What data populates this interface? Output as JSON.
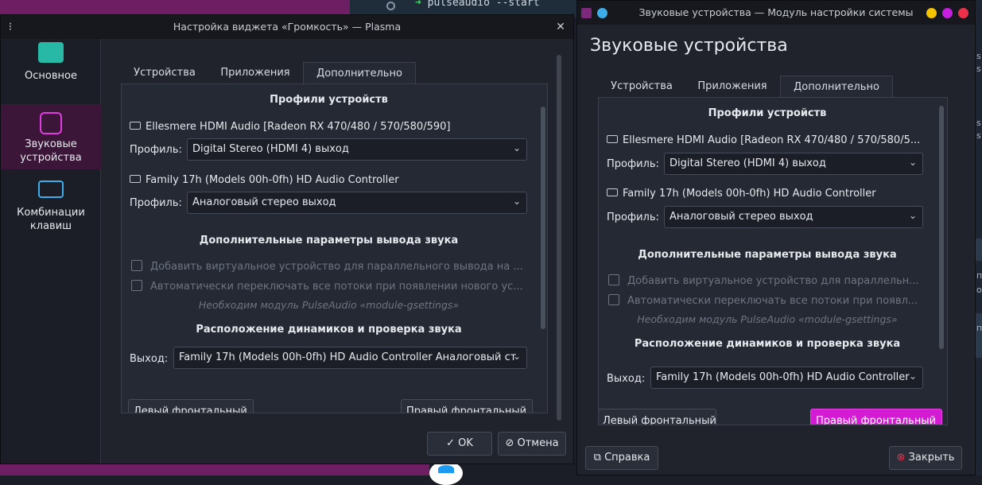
{
  "background": {
    "terminal_command": "pulseaudio --start",
    "terminal_prompt": "➜",
    "strip_texts": [
      "s",
      "s",
      "s",
      "s",
      "пр",
      "оп",
      "пр"
    ]
  },
  "left_window": {
    "title": "Настройка виджета «Громкость» — Plasma",
    "heading_partial": "Звуковые устройства",
    "sidebar": [
      {
        "label": "Основное",
        "icon": "general-settings-icon",
        "active": false
      },
      {
        "label": "Звуковые устройства",
        "icon": "audio-devices-icon",
        "active": true
      },
      {
        "label": "Комбинации клавиш",
        "icon": "keyboard-icon",
        "active": false
      }
    ],
    "tabs": [
      "Устройства",
      "Приложения",
      "Дополнительно"
    ],
    "active_tab": "Дополнительно",
    "profiles_title": "Профили устройств",
    "device1": "Ellesmere HDMI Audio [Radeon RX 470/480 / 570/580/590]",
    "profile_label": "Профиль:",
    "device1_profile": "Digital Stereo (HDMI 4) выход",
    "device2": "Family 17h (Models 00h-0fh) HD Audio Controller",
    "device2_profile": "Аналоговый стерео выход",
    "output_params_title": "Дополнительные параметры вывода звука",
    "option1": "Добавить виртуальное устройство для параллельного вывода на ...",
    "option2": "Автоматически переключать все потоки при появлении нового ус...",
    "module_note": "Необходим модуль PulseAudio «module-gsettings»",
    "speaker_title": "Расположение динамиков и проверка звука",
    "output_label": "Выход:",
    "output_value": "Family 17h (Models 00h-0fh) HD Audio Controller Аналоговый ст",
    "left_front": "Левый фронтальный",
    "right_front": "Правый фронтальный",
    "ok": "OK",
    "cancel": "Отмена"
  },
  "right_window": {
    "title": "Звуковые устройства — Модуль настройки системы",
    "heading": "Звуковые устройства",
    "tabs": [
      "Устройства",
      "Приложения",
      "Дополнительно"
    ],
    "active_tab": "Дополнительно",
    "profiles_title": "Профили устройств",
    "device1": "Ellesmere HDMI Audio [Radeon RX 470/480 / 570/580/5...",
    "profile_label": "Профиль:",
    "device1_profile": "Digital Stereo (HDMI 4) выход",
    "device2": "Family 17h (Models 00h-0fh) HD Audio Controller",
    "device2_profile": "Аналоговый стерео выход",
    "output_params_title": "Дополнительные параметры вывода звука",
    "option1": "Добавить виртуальное устройство для параллельн...",
    "option2": "Автоматически переключать все потоки при появл...",
    "module_note": "Необходим модуль PulseAudio «module-gsettings»",
    "speaker_title": "Расположение динамиков и проверка звука",
    "output_label": "Выход:",
    "output_value": "Family 17h (Models 00h-0fh) HD Audio Controller",
    "left_front": "Левый фронтальный",
    "right_front": "Правый фронтальный",
    "help": "Справка",
    "close": "Закрыть"
  },
  "colors": {
    "accent": "#d41bd4",
    "sidebar_active": "#3c1638",
    "dot_yellow": "#f5c400",
    "dot_magenta": "#c81ee0",
    "dot_red": "#f0304a",
    "dot_blue": "#3daee9"
  }
}
